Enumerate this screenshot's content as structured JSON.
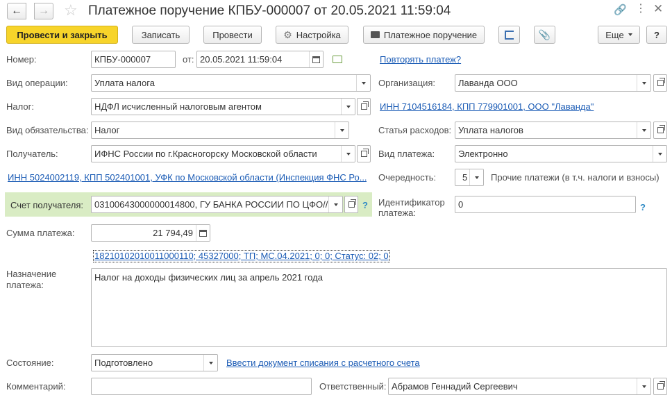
{
  "window": {
    "title": "Платежное поручение КПБУ-000007 от 20.05.2021 11:59:04"
  },
  "toolbar": {
    "post_close": "Провести и закрыть",
    "write": "Записать",
    "post": "Провести",
    "settings": "Настройка",
    "print": "Платежное поручение",
    "more": "Еще",
    "help": "?"
  },
  "form": {
    "number_label": "Номер:",
    "number_value": "КПБУ-000007",
    "date_label": "от:",
    "date_value": "20.05.2021 11:59:04",
    "repeat_link": "Повторять платеж?",
    "operation_label": "Вид операции:",
    "operation_value": "Уплата налога",
    "org_label": "Организация:",
    "org_value": "Лаванда ООО",
    "tax_label": "Налог:",
    "tax_value": "НДФЛ исчисленный налоговым агентом",
    "org_inn_link": "ИНН 7104516184, КПП 779901001, ООО \"Лаванда\"",
    "obligation_label": "Вид обязательства:",
    "obligation_value": "Налог",
    "expense_label": "Статья расходов:",
    "expense_value": "Уплата налогов",
    "recipient_label": "Получатель:",
    "recipient_value": "ИФНС России по г.Красногорску Московской области",
    "payment_type_label": "Вид платежа:",
    "payment_type_value": "Электронно",
    "recipient_inn_link": "ИНН 5024002119, КПП 502401001, УФК по Московской области (Инспекция ФНС Ро...",
    "priority_label": "Очередность:",
    "priority_value": "5",
    "priority_desc": "Прочие платежи (в т.ч. налоги и взносы)",
    "account_label": "Счет получателя:",
    "account_value": "03100643000000014800, ГУ БАНКА РОССИИ ПО ЦФО//",
    "payment_id_label": "Идентификатор платежа:",
    "payment_id_value": "0",
    "amount_label": "Сумма платежа:",
    "amount_value": "21 794,49",
    "details_link": "18210102010011000110; 45327000; ТП; МС.04.2021; 0; 0; Статус: 02; 0",
    "purpose_label": "Назначение платежа:",
    "purpose_value": "Налог на доходы физических лиц за апрель 2021 года",
    "status_label": "Состояние:",
    "status_value": "Подготовлено",
    "writeoff_link": "Ввести документ списания с расчетного счета",
    "comment_label": "Комментарий:",
    "comment_value": "",
    "responsible_label": "Ответственный:",
    "responsible_value": "Абрамов Геннадий Сергеевич"
  },
  "colors": {
    "primary_button": "#f7d42a",
    "link": "#1a5bb5",
    "highlight_row": "#d9ecc4"
  }
}
